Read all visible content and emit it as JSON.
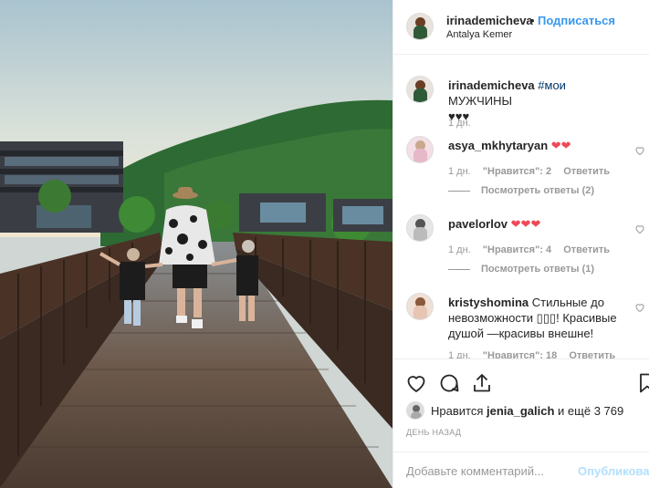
{
  "post": {
    "username": "irinademicheva",
    "dot": "•",
    "follow_label": "Подписаться",
    "location": "Antalya Kemer",
    "more_label": "•••"
  },
  "caption": {
    "username": "irinademicheva",
    "hashtag": "#мои",
    "text": "МУЖЧИНЫ",
    "hearts": "♥♥♥",
    "time": "1 дн."
  },
  "comments": [
    {
      "username": "asya_mkhytaryan",
      "text": "",
      "hearts": "❤❤",
      "time": "1 дн.",
      "likes": "\"Нравится\": 2",
      "reply": "Ответить",
      "view_replies": "Посмотреть ответы (2)"
    },
    {
      "username": "pavelorlov",
      "text": "",
      "hearts": "❤❤❤",
      "time": "1 дн.",
      "likes": "\"Нравится\": 4",
      "reply": "Ответить",
      "view_replies": "Посмотреть ответы (1)"
    },
    {
      "username": "kristyshomina",
      "text": "Стильные до невозможности ▯▯▯! Красивые душой —красивы внешне!",
      "hearts": "",
      "time": "1 дн.",
      "likes": "\"Нравится\": 18",
      "reply": "Ответить",
      "view_replies": ""
    }
  ],
  "likes": {
    "prefix": "Нравится",
    "user": "jenia_galich",
    "suffix": "и ещё 3 769"
  },
  "date_label": "День назад",
  "comment_box": {
    "placeholder": "Добавьте комментарий...",
    "publish_label": "Опубликовать"
  },
  "icons": [
    "heart-icon",
    "comment-icon",
    "share-icon",
    "bookmark-icon",
    "more-icon"
  ],
  "colors": {
    "link": "#3897f0",
    "publish_disabled": "#b2dffc",
    "muted": "#999999",
    "heart": "#ed4956"
  }
}
